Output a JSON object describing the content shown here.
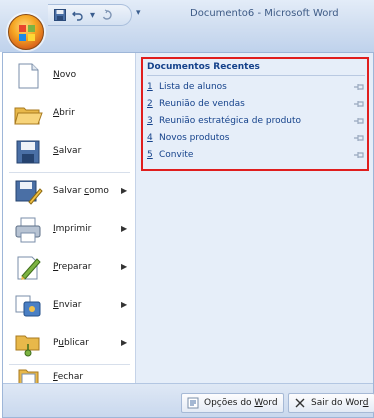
{
  "window": {
    "title": "Documento6 - Microsoft Word",
    "qat_more_glyph": "▾"
  },
  "commands": [
    {
      "id": "novo",
      "label": "Novo",
      "mnemonic_index": 0,
      "has_submenu": false,
      "icon": "new-document-icon"
    },
    {
      "id": "abrir",
      "label": "Abrir",
      "mnemonic_index": 0,
      "has_submenu": false,
      "icon": "open-folder-icon"
    },
    {
      "id": "salvar",
      "label": "Salvar",
      "mnemonic_index": 0,
      "has_submenu": false,
      "icon": "save-disk-icon"
    },
    {
      "id": "salvar-como",
      "label": "Salvar como",
      "mnemonic_index": 7,
      "has_submenu": true,
      "icon": "save-as-icon"
    },
    {
      "id": "imprimir",
      "label": "Imprimir",
      "mnemonic_index": 0,
      "has_submenu": true,
      "icon": "printer-icon"
    },
    {
      "id": "preparar",
      "label": "Preparar",
      "mnemonic_index": 0,
      "has_submenu": true,
      "icon": "prepare-icon"
    },
    {
      "id": "enviar",
      "label": "Enviar",
      "mnemonic_index": 0,
      "has_submenu": true,
      "icon": "send-icon"
    },
    {
      "id": "publicar",
      "label": "Publicar",
      "mnemonic_index": 1,
      "has_submenu": true,
      "icon": "publish-icon"
    },
    {
      "id": "fechar",
      "label": "Fechar",
      "mnemonic_index": 0,
      "has_submenu": false,
      "icon": "close-document-icon"
    }
  ],
  "submenu_arrow": "▶",
  "recent": {
    "title": "Documentos Recentes",
    "items": [
      {
        "num": "1",
        "name": "Lista de alunos"
      },
      {
        "num": "2",
        "name": "Reunião de vendas"
      },
      {
        "num": "3",
        "name": "Reunião estratégica de produto"
      },
      {
        "num": "4",
        "name": "Novos produtos"
      },
      {
        "num": "5",
        "name": "Convite"
      }
    ],
    "highlight_color": "#e01e1e"
  },
  "footer": {
    "options_prefix": "Opções do ",
    "options_mnemonic": "W",
    "options_suffix": "ord",
    "exit_prefix": "Sair do Wor",
    "exit_mnemonic": "d",
    "exit_suffix": ""
  },
  "colors": {
    "menu_bg": "#e6eef9",
    "link_text": "#15428b",
    "office_orange": "#f5a623"
  }
}
